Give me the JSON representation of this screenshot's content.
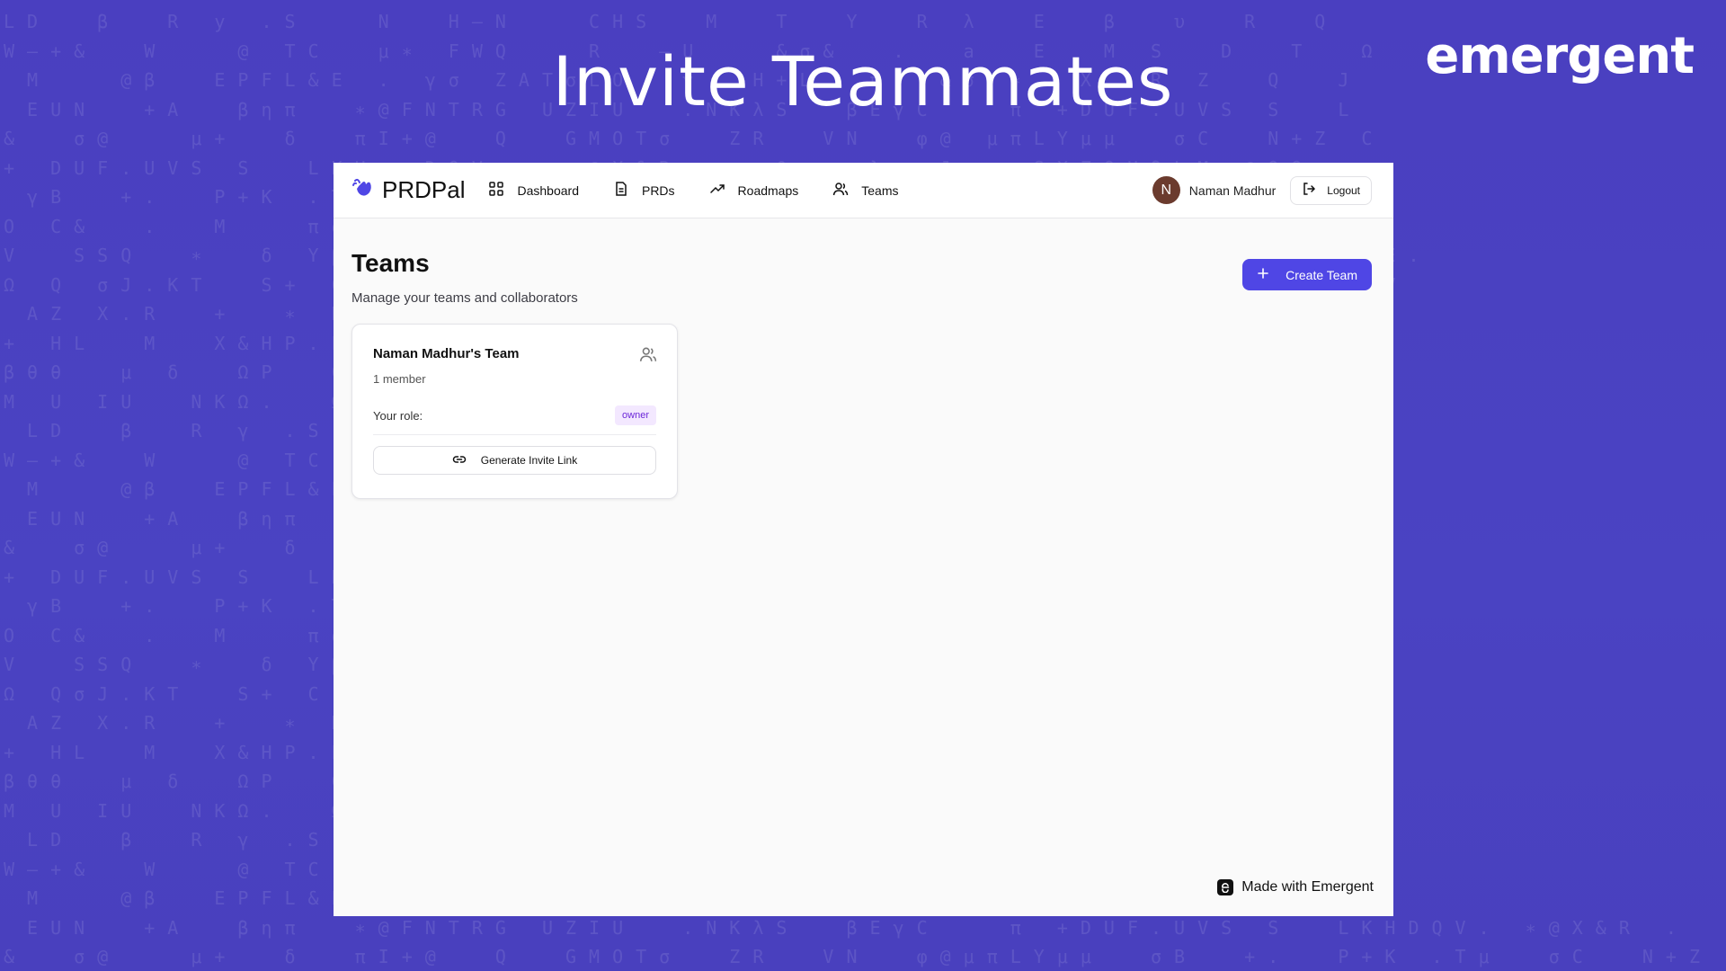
{
  "banner": {
    "title": "Invite Teammates",
    "brand": "emergent"
  },
  "app": {
    "logo_text": "PRDPal",
    "logo_icon": "hand-wave-icon",
    "accent_color": "#4f46e5"
  },
  "nav": {
    "items": [
      {
        "label": "Dashboard",
        "icon": "grid-icon"
      },
      {
        "label": "PRDs",
        "icon": "document-icon"
      },
      {
        "label": "Roadmaps",
        "icon": "trending-up-icon"
      },
      {
        "label": "Teams",
        "icon": "users-icon"
      }
    ]
  },
  "user": {
    "initial": "N",
    "name": "Naman Madhur",
    "logout_label": "Logout"
  },
  "page": {
    "title": "Teams",
    "subtitle": "Manage your teams and collaborators",
    "create_button": "Create Team"
  },
  "team_card": {
    "name": "Naman Madhur's Team",
    "members": "1 member",
    "role_label": "Your role:",
    "role": "owner",
    "invite_button": "Generate Invite Link"
  },
  "footer": {
    "made_with": "Made with Emergent"
  }
}
